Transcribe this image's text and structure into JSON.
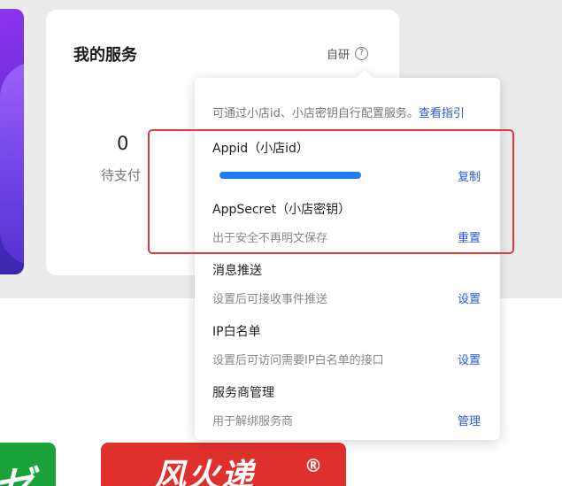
{
  "card": {
    "title": "我的服务",
    "self_dev_label": "自研",
    "help_icon_glyph": "?",
    "stat_value": "0",
    "stat_label": "待支付"
  },
  "popover": {
    "hint_text": "可通过小店id、小店密钥自行配置服务。",
    "hint_link": "查看指引",
    "rows": [
      {
        "title": "Appid（小店id）",
        "desc": "",
        "action": "复制",
        "masked": true
      },
      {
        "title": "AppSecret（小店密钥）",
        "desc": "出于安全不再明文保存",
        "action": "重置"
      },
      {
        "title": "消息推送",
        "desc": "设置后可接收事件推送",
        "action": "设置"
      },
      {
        "title": "IP白名单",
        "desc": "设置后可访问需要IP白名单的接口",
        "action": "设置"
      },
      {
        "title": "服务商管理",
        "desc": "用于解绑服务商",
        "action": "管理"
      }
    ]
  },
  "tiles": {
    "red_logo_text": "风火递",
    "red_logo_reg": "®",
    "green_glyph": "ゼ"
  },
  "colors": {
    "link": "#2b5ad9",
    "highlight": "#e53935",
    "masked_stroke": "#1d7cf2"
  }
}
